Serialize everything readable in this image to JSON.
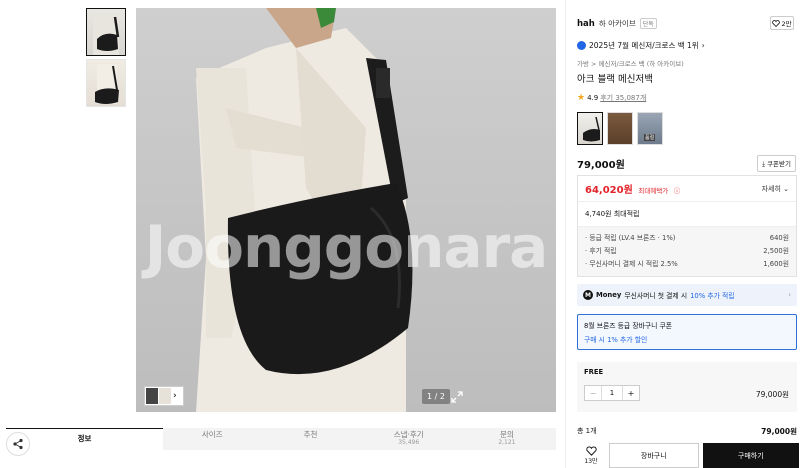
{
  "gallery": {
    "counter_current": "1",
    "counter_sep": "/",
    "counter_total": "2",
    "watermark": "Joonggonara"
  },
  "tabs": [
    {
      "label": "정보",
      "count": ""
    },
    {
      "label": "사이즈",
      "count": ""
    },
    {
      "label": "추천",
      "count": ""
    },
    {
      "label": "스냅·후기",
      "count": "35,496"
    },
    {
      "label": "문의",
      "count": "2,121"
    }
  ],
  "product": {
    "brand_logo": "hah",
    "brand_name": "하 아카이브",
    "brand_badge": "단독",
    "like_count": "2만",
    "rank_text": "2025년 7월 메신저/크로스 백 1위",
    "rank_arrow": "›",
    "breadcrumb": "가방 > 메신저/크로스 백 (하 아카이브)",
    "title": "아크 블랙 메신저백",
    "rating": "4.9",
    "review_text": "후기 35,087개",
    "swatch_tag": "품절",
    "price": "79,000원",
    "coupon_button": "쿠폰받기"
  },
  "benefit": {
    "max_price": "64,020원",
    "max_label": "최대혜택가",
    "detail_link": "자세히",
    "points_line": "4,740원 최대적립",
    "point_rows": [
      {
        "label": "· 등급 적립 (LV.4 브론즈 · 1%)",
        "value": "640원"
      },
      {
        "label": "· 후기 적립",
        "value": "2,500원"
      },
      {
        "label": "· 무신사머니 결제 시 적립 2.5%",
        "value": "1,600원"
      }
    ]
  },
  "money": {
    "badge": "M",
    "brand": "Money",
    "text": "무신사머니 첫 결제 시",
    "highlight": "10% 추가 적립",
    "arrow": "›"
  },
  "coupon_box": {
    "line1": "8월 브론즈 등급 장바구니 쿠폰",
    "line2": "구매 시 1% 추가 할인"
  },
  "option": {
    "label": "FREE",
    "minus": "−",
    "qty": "1",
    "plus": "+",
    "price": "79,000원"
  },
  "total": {
    "label": "총 1개",
    "value": "79,000원"
  },
  "actions": {
    "like_count": "13만",
    "cart_label": "장바구니",
    "buy_label": "구매하기"
  },
  "colors": {
    "accent_blue": "#2166e5",
    "sale_red": "#e2232a",
    "bag_black": "#1a1a1a",
    "coat_cream": "#eeeae2"
  }
}
